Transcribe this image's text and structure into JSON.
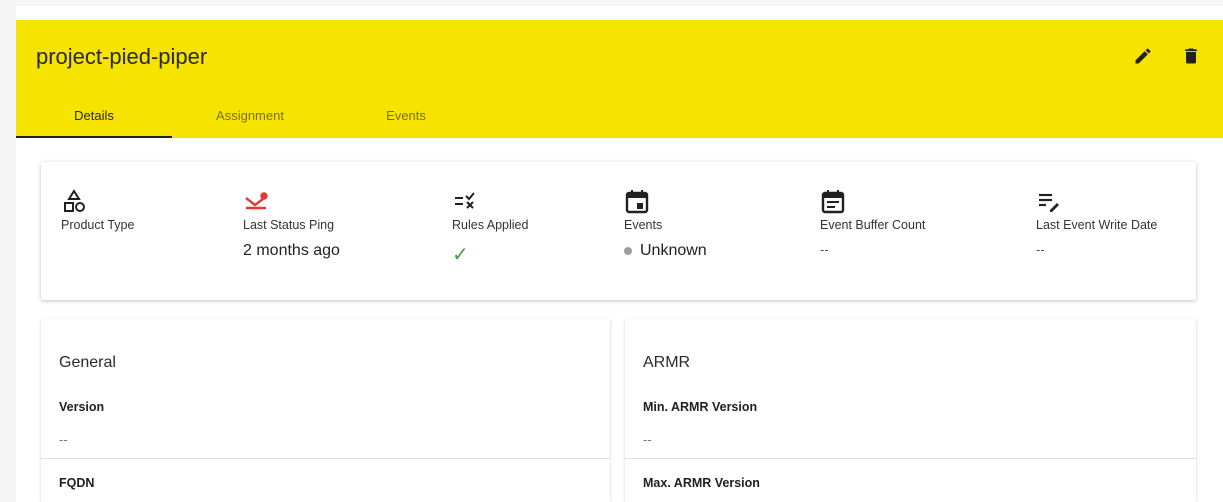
{
  "header": {
    "title": "project-pied-piper",
    "edit_icon": "pencil-icon",
    "delete_icon": "trash-icon",
    "background_color": "#f7e300"
  },
  "tabs": [
    {
      "label": "Details",
      "active": true
    },
    {
      "label": "Assignment",
      "active": false
    },
    {
      "label": "Events",
      "active": false
    }
  ],
  "status": {
    "product_type": {
      "label": "Product Type",
      "icon": "shapes-icon"
    },
    "last_status_ping": {
      "label": "Last Status Ping",
      "value": "2 months ago",
      "icon": "ping-status-icon",
      "icon_color": "#e53935"
    },
    "rules_applied": {
      "label": "Rules Applied",
      "value": "✓",
      "icon": "checklist-icon",
      "value_color": "#43a047"
    },
    "events": {
      "label": "Events",
      "value": "Unknown",
      "icon": "calendar-icon",
      "dot_color": "#9e9e9e"
    },
    "event_buffer_count": {
      "label": "Event Buffer Count",
      "value": "--",
      "icon": "calendar-text-icon"
    },
    "last_event_write_date": {
      "label": "Last Event Write Date",
      "value": "--",
      "icon": "list-edit-icon"
    }
  },
  "general": {
    "title": "General",
    "version_label": "Version",
    "version_value": "--",
    "fqdn_label": "FQDN"
  },
  "armr": {
    "title": "ARMR",
    "min_version_label": "Min. ARMR Version",
    "min_version_value": "--",
    "max_version_label": "Max. ARMR Version"
  }
}
